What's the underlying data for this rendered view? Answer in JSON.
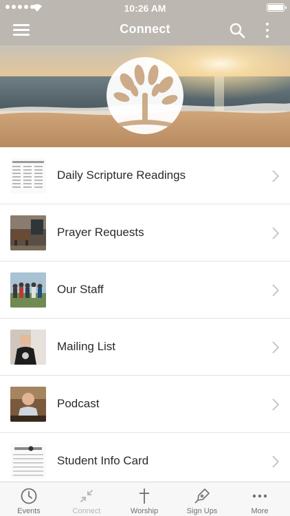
{
  "status_bar": {
    "time": "10:26 AM"
  },
  "nav": {
    "title": "Connect",
    "menu_icon": "hamburger-icon",
    "search_icon": "search-icon",
    "more_icon": "vertical-dots-icon"
  },
  "hero": {
    "logo": "tree-logo",
    "background": "beach-sunrise"
  },
  "list": {
    "items": [
      {
        "label": "Daily Scripture Readings",
        "thumb": "scripture-document"
      },
      {
        "label": "Prayer Requests",
        "thumb": "room-photo"
      },
      {
        "label": "Our Staff",
        "thumb": "group-photo"
      },
      {
        "label": "Mailing List",
        "thumb": "person-photo"
      },
      {
        "label": "Podcast",
        "thumb": "speaker-photo"
      },
      {
        "label": "Student Info Card",
        "thumb": "card-document"
      }
    ]
  },
  "tabbar": {
    "tabs": [
      {
        "label": "Events",
        "icon": "clock-icon"
      },
      {
        "label": "Connect",
        "icon": "compress-arrows-icon"
      },
      {
        "label": "Worship",
        "icon": "cross-icon"
      },
      {
        "label": "Sign Ups",
        "icon": "pen-nib-icon"
      },
      {
        "label": "More",
        "icon": "dots-icon"
      }
    ]
  },
  "colors": {
    "nav_bg": "#bcb7b0",
    "tab_bg": "#f7f7f7",
    "label_text": "#2a2a2a",
    "chevron": "#c7c7cc"
  }
}
